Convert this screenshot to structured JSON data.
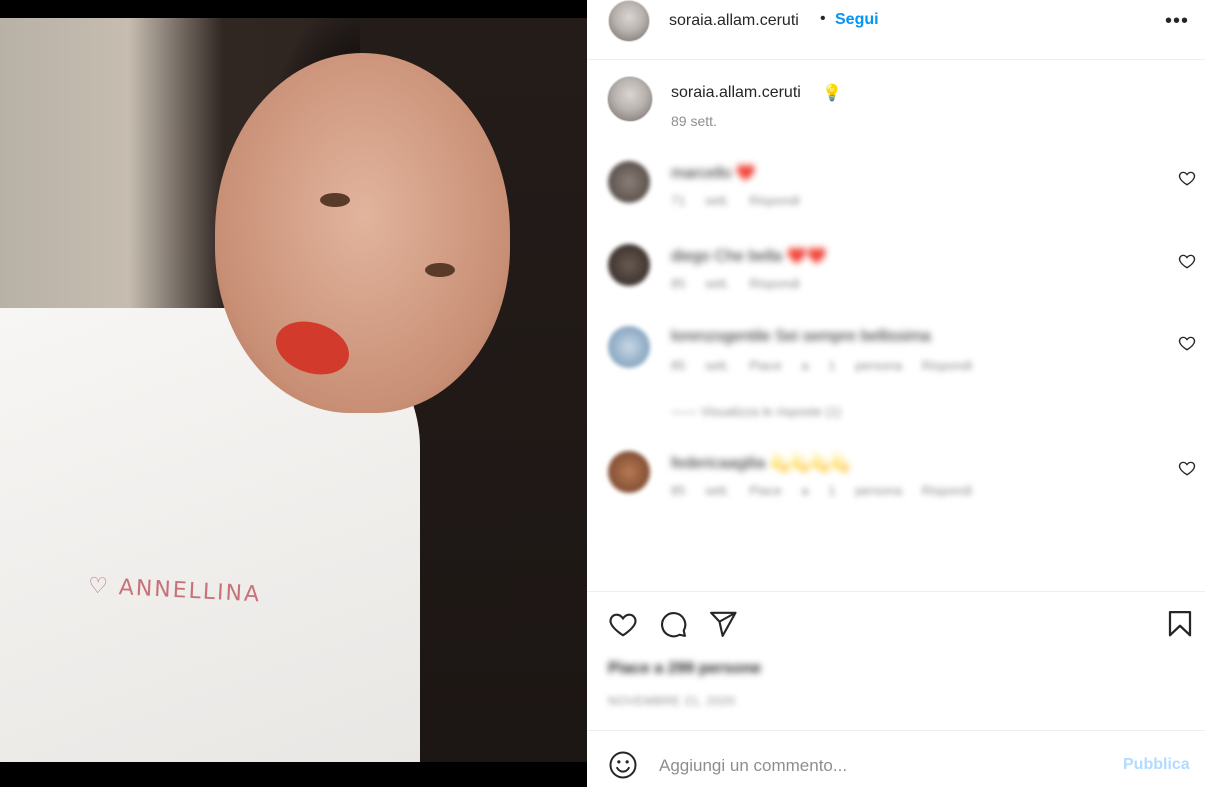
{
  "post": {
    "author": "soraia.allam.ceruti",
    "follow_label": "Segui",
    "dot": "•",
    "more_icon": "more-options-icon",
    "more_glyph": "•••",
    "shirt_text": "♡ ANNELLINA"
  },
  "caption": {
    "author": "soraia.allam.ceruti",
    "emoji": "💡",
    "time": "89 sett."
  },
  "comments": [
    {
      "text": "marcello ❤️",
      "meta": "71 sett.  Rispondi"
    },
    {
      "text": "diego Che bella ❤️❤️",
      "meta": "85 sett.  Rispondi"
    },
    {
      "text": "lorenzogentile Sei sempre bellissima",
      "meta": "85 sett.  Piace a 1 persona  Rispondi"
    },
    {
      "text": "federicaagilia 💫💫💫💫",
      "meta": "85 sett.  Piace a 1 persona  Rispondi"
    }
  ],
  "view_replies": "——  Visualizza le risposte (1)",
  "likes": "Piace a 299 persone",
  "date": "NOVEMBRE 21, 2020",
  "add_comment": {
    "placeholder": "Aggiungi un commento...",
    "post_label": "Pubblica"
  },
  "colors": {
    "accent": "#0095f6",
    "publish_disabled": "#b3dbff",
    "border": "#efefef",
    "meta_text": "#8e8e8e"
  }
}
